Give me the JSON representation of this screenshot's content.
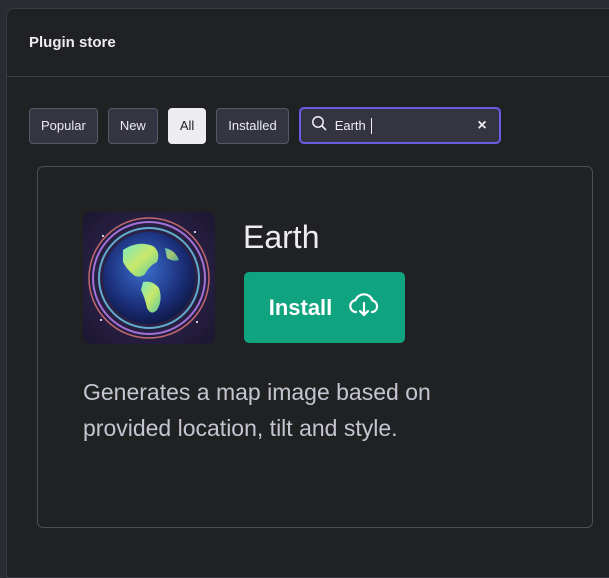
{
  "modal": {
    "title": "Plugin store"
  },
  "filters": {
    "tabs": [
      {
        "label": "Popular",
        "active": false
      },
      {
        "label": "New",
        "active": false
      },
      {
        "label": "All",
        "active": true
      },
      {
        "label": "Installed",
        "active": false
      }
    ]
  },
  "search": {
    "value": "Earth",
    "clear_icon": "×"
  },
  "plugin": {
    "name": "Earth",
    "install_label": "Install",
    "description": "Generates a map image based on provided location, tilt and style."
  },
  "colors": {
    "accent": "#10a37f",
    "focus": "#6b5ce7",
    "background": "#202123"
  }
}
